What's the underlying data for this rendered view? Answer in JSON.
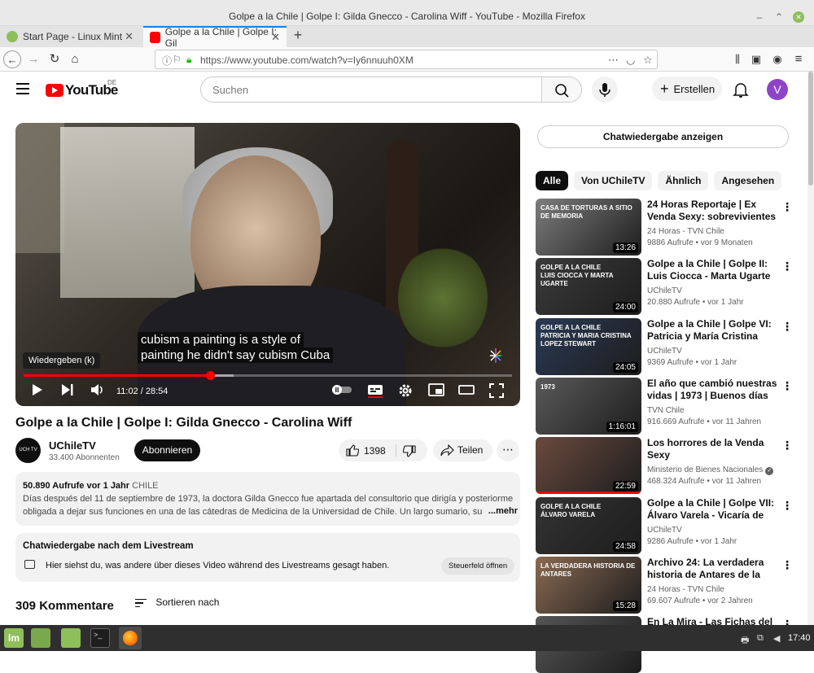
{
  "window": {
    "title": "Golpe a la Chile | Golpe I: Gilda Gnecco - Carolina Wiff - YouTube - Mozilla Firefox",
    "tabs": [
      {
        "label": "Start Page - Linux Mint"
      },
      {
        "label": "Golpe a la Chile | Golpe I: Gil"
      }
    ],
    "url": "https://www.youtube.com/watch?v=Iy6nnuuh0XM"
  },
  "yt_header": {
    "logo_text": "YouTube",
    "region": "DE",
    "search_placeholder": "Suchen",
    "create_label": "Erstellen",
    "avatar_letter": "V"
  },
  "player": {
    "subtitle_line1": "cubism a painting is a style of",
    "subtitle_line2": "painting he didn't say cubism Cuba",
    "tooltip": "Wiedergeben (k)",
    "time": "11:02 / 28:54",
    "played_fraction": 0.382,
    "loaded_fraction": 0.43
  },
  "video": {
    "title": "Golpe a la Chile | Golpe I: Gilda Gnecco - Carolina Wiff",
    "channel": "UChileTV",
    "channel_avatar_text": "UCH TV",
    "subscribers": "33.400 Abonnenten",
    "subscribe_label": "Abonnieren",
    "likes": "1398",
    "share_label": "Teilen",
    "more_label": "⋯"
  },
  "description": {
    "views": "50.890 Aufrufe",
    "age": "vor 1 Jahr",
    "tag": "CHILE",
    "line1": "Días después del 11 de septiembre de 1973, la doctora Gilda Gnecco fue apartada del consultorio que dirigía y posteriormente",
    "line2": "obligada a dejar sus funciones en una de las cátedras de Medicina de la Universidad de Chile. Un largo sumario, su expu",
    "more": "...mehr"
  },
  "chat_replay_box": {
    "heading": "Chatwiedergabe nach dem Livestream",
    "text": "Hier siehst du, was andere über dieses Video während des Livestreams gesagt haben.",
    "button": "Steuerfeld öffnen"
  },
  "comments": {
    "count_label": "309 Kommentare",
    "sort_label": "Sortieren nach"
  },
  "sidebar": {
    "chat_replay_button": "Chatwiedergabe anzeigen",
    "chips": [
      "Alle",
      "Von UChileTV",
      "Ähnlich",
      "Angesehen"
    ],
    "recommendations": [
      {
        "title": "24 Horas Reportaje | Ex Venda Sexy: sobrevivientes recupera…",
        "channel": "24 Horas - TVN Chile",
        "views": "9886 Aufrufe",
        "age": "vor 9 Monaten",
        "duration": "13:26",
        "thumb_text": "CASA DE TORTURAS A SITIO DE MEMORIA",
        "color": "#7d7d7d",
        "watched": 0
      },
      {
        "title": "Golpe a la Chile | Golpe II: Luis Ciocca - Marta Ugarte",
        "channel": "UChileTV",
        "views": "20.880 Aufrufe",
        "age": "vor 1 Jahr",
        "duration": "24:00",
        "thumb_text": "GOLPE A LA CHILE\nLUIS CIOCCA Y MARTA UGARTE",
        "color": "#3b3b3b",
        "watched": 0
      },
      {
        "title": "Golpe a la Chile | Golpe VI: Patricia y María Cristina Lópe…",
        "channel": "UChileTV",
        "views": "9369 Aufrufe",
        "age": "vor 1 Jahr",
        "duration": "24:05",
        "thumb_text": "GOLPE A LA CHILE\nPATRICIA Y MARIA CRISTINA LOPEZ STEWART",
        "color": "#2a3a55",
        "watched": 0
      },
      {
        "title": "El año que cambió nuestras vidas | 1973 | Buenos días a…",
        "channel": "TVN Chile",
        "views": "916.669 Aufrufe",
        "age": "vor 11 Jahren",
        "duration": "1:16:01",
        "thumb_text": "1973",
        "color": "#5a5a5a",
        "watched": 0
      },
      {
        "title": "Los horrores de la Venda Sexy",
        "channel": "Ministerio de Bienes Nacionales",
        "views": "468.324 Aufrufe",
        "age": "vor 11 Jahren",
        "duration": "22:59",
        "thumb_text": "",
        "color": "#6b4a3e",
        "watched": 1,
        "verified": true
      },
      {
        "title": "Golpe a la Chile | Golpe VII: Álvaro Varela - Vicaría de la…",
        "channel": "UChileTV",
        "views": "9286 Aufrufe",
        "age": "vor 1 Jahr",
        "duration": "24:58",
        "thumb_text": "GOLPE A LA CHILE\nÁLVARO VARELA",
        "color": "#333333",
        "watched": 0
      },
      {
        "title": "Archivo 24: La verdadera historia de Antares de la Luz",
        "channel": "24 Horas - TVN Chile",
        "views": "69.607 Aufrufe",
        "age": "vor 2 Jahren",
        "duration": "15:28",
        "thumb_text": "LA VERDADERA HISTORIA DE ANTARES",
        "color": "#8a6a52",
        "watched": 0
      },
      {
        "title": "En La Mira - Las Fichas del",
        "channel": "",
        "views": "",
        "age": "",
        "duration": "",
        "thumb_text": "",
        "color": "#555555",
        "watched": 0
      }
    ]
  },
  "taskbar": {
    "clock": "17:40",
    "terminal_glyph": ">_"
  }
}
